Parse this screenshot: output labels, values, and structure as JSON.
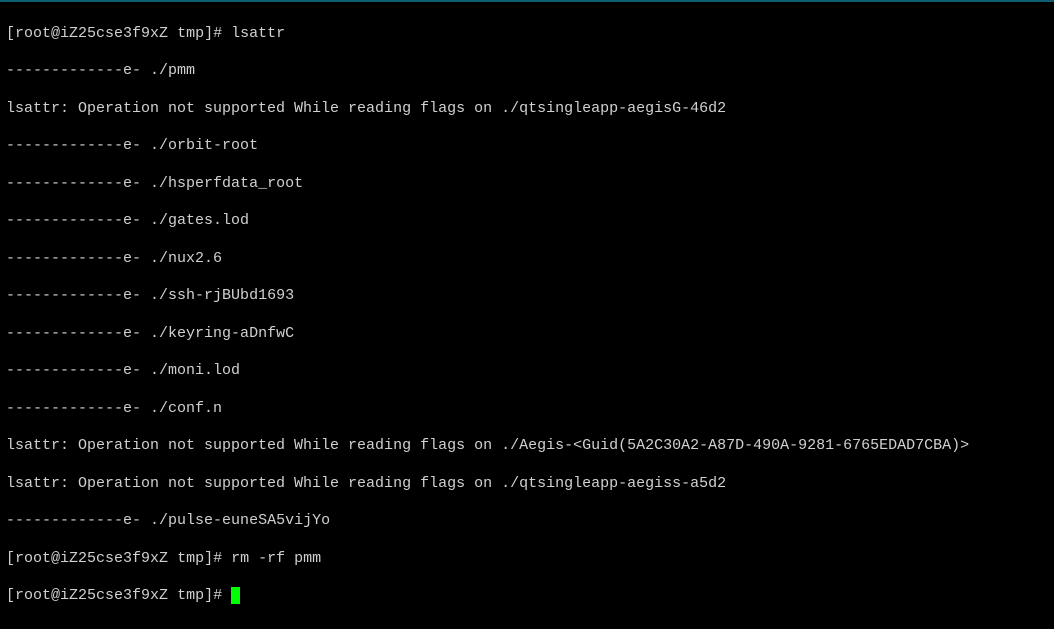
{
  "prompt": {
    "user_host": "root@iZ25cse3f9xZ",
    "cwd": "tmp"
  },
  "commands": {
    "cmd1": "lsattr",
    "cmd2": "rm -rf pmm",
    "cmd3": ""
  },
  "attrs": "-------------e-",
  "files": {
    "f1": "./pmm",
    "f2": "./orbit-root",
    "f3": "./hsperfdata_root",
    "f4": "./gates.lod",
    "f5": "./nux2.6",
    "f6": "./ssh-rjBUbd1693",
    "f7": "./keyring-aDnfwC",
    "f8": "./moni.lod",
    "f9": "./conf.n",
    "f10": "./pulse-euneSA5vijYo"
  },
  "errors": {
    "e1": "lsattr: Operation not supported While reading flags on ./qtsingleapp-aegisG-46d2",
    "e2": "lsattr: Operation not supported While reading flags on ./Aegis-<Guid(5A2C30A2-A87D-490A-9281-6765EDAD7CBA)>",
    "e3": "lsattr: Operation not supported While reading flags on ./qtsingleapp-aegiss-a5d2"
  }
}
